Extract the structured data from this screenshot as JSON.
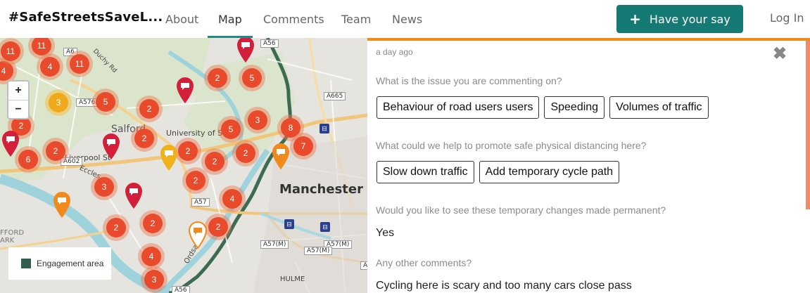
{
  "header": {
    "brand": "#SafeStreetsSaveL...",
    "nav": [
      {
        "label": "About"
      },
      {
        "label": "Map"
      },
      {
        "label": "Comments"
      },
      {
        "label": "Team"
      },
      {
        "label": "News"
      }
    ],
    "active_nav": "Map",
    "cta_label": "Have your say",
    "login_label": "Log In",
    "accent_color": "#157a74"
  },
  "map": {
    "zoom_in": "+",
    "zoom_out": "−",
    "legend_label": "Engagement area",
    "place_labels": {
      "salford": "Salford",
      "manchester": "Manchester",
      "university": "University of Sa...",
      "liverpool_st": "Liverpool St",
      "ordsall": "Ordsall",
      "hulme": "HULME",
      "ford_park": "FFORD\nARK",
      "duchy_rd": "Duchy Rd",
      "eccles": "Eccles"
    },
    "road_shields": [
      "A56",
      "A665",
      "A576",
      "A6",
      "A602",
      "A57",
      "A57(M)",
      "A57(M)",
      "A57(M)",
      "A56",
      "A6"
    ],
    "clusters": [
      "11",
      "11",
      "4",
      "4",
      "11",
      "3",
      "5",
      "2",
      "2",
      "5",
      "2",
      "3",
      "8",
      "2",
      "2",
      "6",
      "2",
      "5",
      "2",
      "7",
      "2",
      "2",
      "3",
      "4",
      "2",
      "2",
      "2",
      "4",
      "3"
    ]
  },
  "comment": {
    "time": "a day ago",
    "close_icon": "close-icon",
    "q1": "What is the issue you are commenting on?",
    "q1_tags": [
      {
        "label": "Behaviour of road users users"
      },
      {
        "label": "Speeding"
      },
      {
        "label": "Volumes of traffic"
      }
    ],
    "q2": "What could we help to promote safe physical distancing here?",
    "q2_tags": [
      {
        "label": "Slow down traffic"
      },
      {
        "label": "Add temporary cycle path"
      }
    ],
    "q3": "Would you like to see these temporary changes made permanent?",
    "a3": "Yes",
    "q4": "Any other comments?",
    "a4": "Cycling here is scary and too many cars close pass"
  }
}
